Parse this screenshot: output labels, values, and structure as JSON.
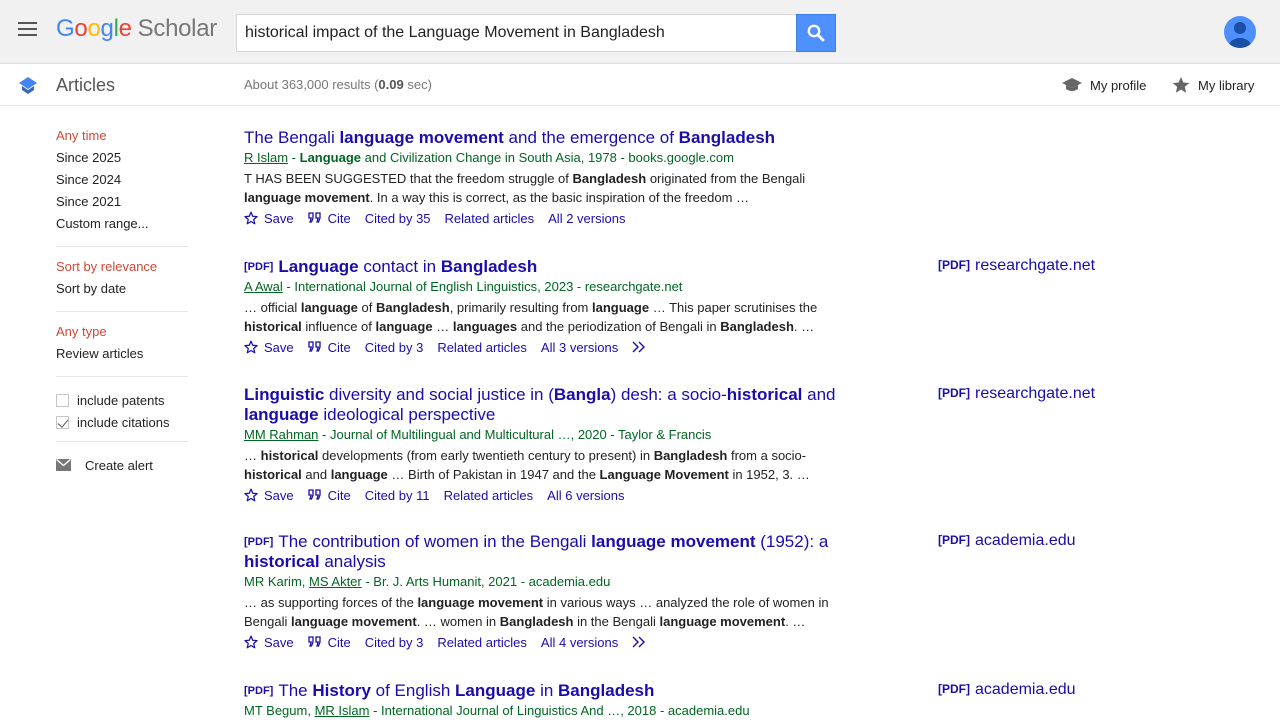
{
  "app": {
    "logo_google": [
      "G",
      "o",
      "o",
      "g",
      "l",
      "e"
    ],
    "logo_suffix": "Scholar"
  },
  "search": {
    "query": "historical impact of the Language Movement in Bangladesh"
  },
  "subbar": {
    "section": "Articles",
    "count_prefix": "About 363,000 results (",
    "count_time": "0.09",
    "count_suffix": " sec)",
    "my_profile": "My profile",
    "my_library": "My library"
  },
  "sidebar": {
    "time": [
      "Any time",
      "Since 2025",
      "Since 2024",
      "Since 2021",
      "Custom range..."
    ],
    "sort": [
      "Sort by relevance",
      "Sort by date"
    ],
    "type": [
      "Any type",
      "Review articles"
    ],
    "include_patents": "include patents",
    "include_citations": "include citations",
    "create_alert": "Create alert"
  },
  "results": [
    {
      "pdf": "",
      "title_parts": [
        [
          "The Bengali ",
          false
        ],
        [
          "language movement",
          true
        ],
        [
          " and the emergence of ",
          false
        ],
        [
          "Bangladesh",
          true
        ]
      ],
      "authors": [
        [
          "R Islam",
          true
        ]
      ],
      "source_parts": [
        [
          " - ",
          false
        ],
        [
          "Language",
          true
        ],
        [
          " and Civilization Change in South Asia, 1978 - books.google.com",
          false
        ]
      ],
      "snippet": [
        [
          "T HAS BEEN SUGGESTED that the freedom struggle of ",
          false
        ],
        [
          "Bangladesh",
          true
        ],
        [
          " originated from the Bengali ",
          false
        ],
        [
          "language movement",
          true
        ],
        [
          ". In a way this is correct, as the basic inspiration of the freedom …",
          false
        ]
      ],
      "cited": "Cited by 35",
      "versions": "All 2 versions",
      "more": false,
      "side_link": ""
    },
    {
      "pdf": "[PDF]",
      "title_parts": [
        [
          "Language",
          true
        ],
        [
          " contact in ",
          false
        ],
        [
          "Bangladesh",
          true
        ]
      ],
      "authors": [
        [
          "A Awal",
          true
        ]
      ],
      "source_parts": [
        [
          " - International Journal of English Linguistics, 2023 - researchgate.net",
          false
        ]
      ],
      "snippet": [
        [
          "… official ",
          false
        ],
        [
          "language",
          true
        ],
        [
          " of ",
          false
        ],
        [
          "Bangladesh",
          true
        ],
        [
          ", primarily resulting from ",
          false
        ],
        [
          "language",
          true
        ],
        [
          " … This paper scrutinises the ",
          false
        ],
        [
          "historical",
          true
        ],
        [
          " influence of ",
          false
        ],
        [
          "language",
          true
        ],
        [
          " … ",
          false
        ],
        [
          "languages",
          true
        ],
        [
          " and the periodization of Bengali in ",
          false
        ],
        [
          "Bangladesh",
          true
        ],
        [
          ". …",
          false
        ]
      ],
      "cited": "Cited by 3",
      "versions": "All 3 versions",
      "more": true,
      "side_link": "researchgate.net"
    },
    {
      "pdf": "",
      "title_parts": [
        [
          "Linguistic",
          true
        ],
        [
          " diversity and social justice in (",
          false
        ],
        [
          "Bangla",
          true
        ],
        [
          ") desh: a socio-",
          false
        ],
        [
          "historical",
          true
        ],
        [
          " and ",
          false
        ],
        [
          "language",
          true
        ],
        [
          " ideological perspective",
          false
        ]
      ],
      "authors": [
        [
          "MM Rahman",
          true
        ]
      ],
      "source_parts": [
        [
          " - Journal of Multilingual and Multicultural …, 2020 - Taylor & Francis",
          false
        ]
      ],
      "snippet": [
        [
          "… ",
          false
        ],
        [
          "historical",
          true
        ],
        [
          " developments (from early twentieth century to present) in ",
          false
        ],
        [
          "Bangladesh",
          true
        ],
        [
          " from a socio-",
          false
        ],
        [
          "historical",
          true
        ],
        [
          " and ",
          false
        ],
        [
          "language",
          true
        ],
        [
          " … Birth of Pakistan in 1947 and the ",
          false
        ],
        [
          "Language Movement",
          true
        ],
        [
          " in 1952, 3. …",
          false
        ]
      ],
      "cited": "Cited by 11",
      "versions": "All 6 versions",
      "more": false,
      "side_link": "researchgate.net"
    },
    {
      "pdf": "[PDF]",
      "title_parts": [
        [
          "The contribution of women in the Bengali ",
          false
        ],
        [
          "language movement",
          true
        ],
        [
          " (1952): a ",
          false
        ],
        [
          "historical",
          true
        ],
        [
          " analysis",
          false
        ]
      ],
      "authors": [
        [
          "MR Karim, ",
          false
        ],
        [
          "MS Akter",
          true
        ]
      ],
      "source_parts": [
        [
          " - Br. J. Arts Humanit, 2021 - academia.edu",
          false
        ]
      ],
      "snippet": [
        [
          "… as supporting forces of the ",
          false
        ],
        [
          "language movement",
          true
        ],
        [
          " in various ways … analyzed the role of women in Bengali ",
          false
        ],
        [
          "language movement",
          true
        ],
        [
          ". … women in ",
          false
        ],
        [
          "Bangladesh",
          true
        ],
        [
          " in the Bengali ",
          false
        ],
        [
          "language movement",
          true
        ],
        [
          ". …",
          false
        ]
      ],
      "cited": "Cited by 3",
      "versions": "All 4 versions",
      "more": true,
      "side_link": "academia.edu"
    },
    {
      "pdf": "[PDF]",
      "title_parts": [
        [
          "The ",
          false
        ],
        [
          "History",
          true
        ],
        [
          " of English ",
          false
        ],
        [
          "Language",
          true
        ],
        [
          " in ",
          false
        ],
        [
          "Bangladesh",
          true
        ]
      ],
      "authors": [
        [
          "MT Begum, ",
          false
        ],
        [
          "MR Islam",
          true
        ]
      ],
      "source_parts": [
        [
          " - International Journal of Linguistics And …, 2018 - academia.edu",
          false
        ]
      ],
      "snippet": [],
      "cited": "",
      "versions": "",
      "more": false,
      "side_link": "academia.edu"
    }
  ],
  "actions": {
    "save": "Save",
    "cite": "Cite",
    "related": "Related articles"
  },
  "labels": {
    "pdf_tag": "[PDF]"
  },
  "colors": {
    "link": "#1a0dab",
    "meta_green": "#006621",
    "active_red": "#d14836",
    "search_blue": "#4d90fe"
  }
}
